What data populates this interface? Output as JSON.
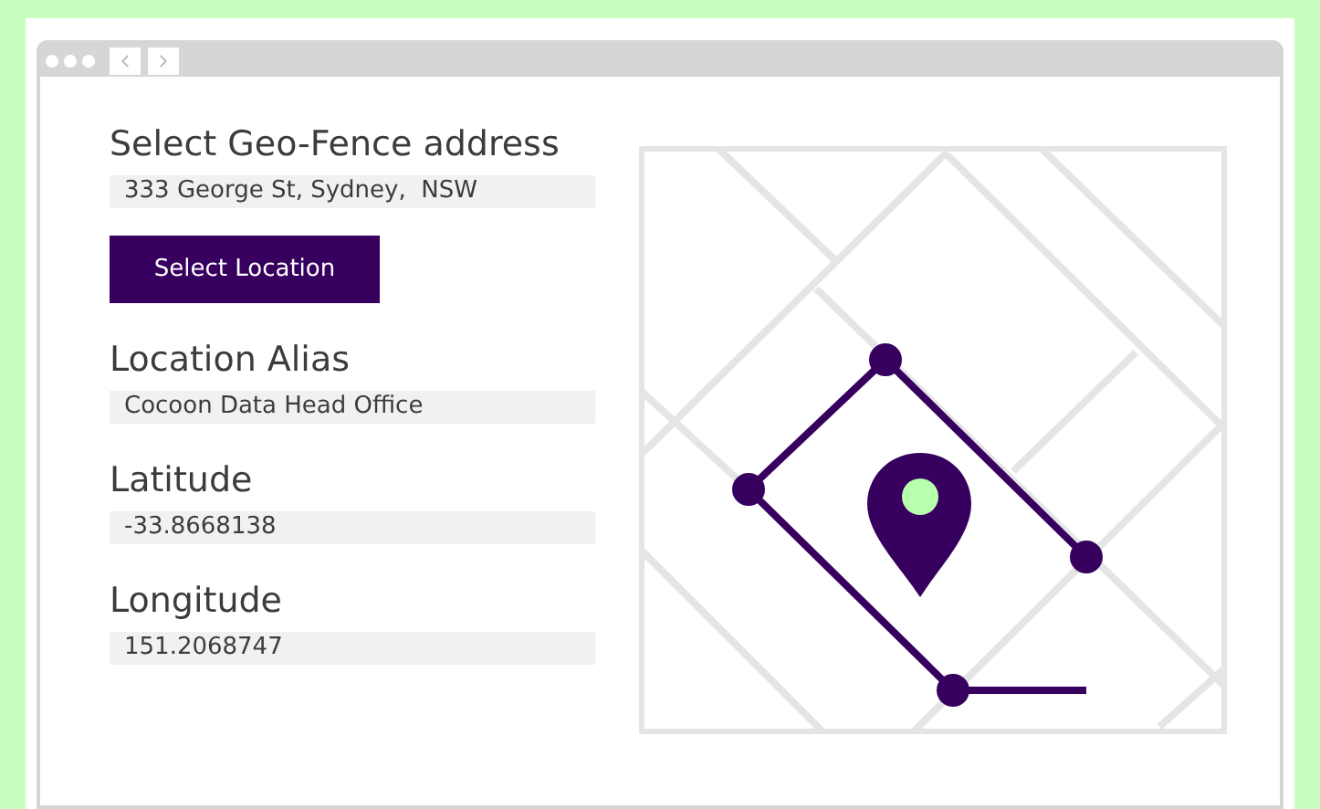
{
  "form": {
    "title": "Select Geo-Fence address",
    "address": "333 George St, Sydney,  NSW",
    "button": "Select Location",
    "fields": [
      {
        "label": "Location Alias",
        "value": "Cocoon Data Head Office"
      },
      {
        "label": "Latitude",
        "value": "-33.8668138"
      },
      {
        "label": "Longitude",
        "value": "151.2068747"
      }
    ]
  }
}
